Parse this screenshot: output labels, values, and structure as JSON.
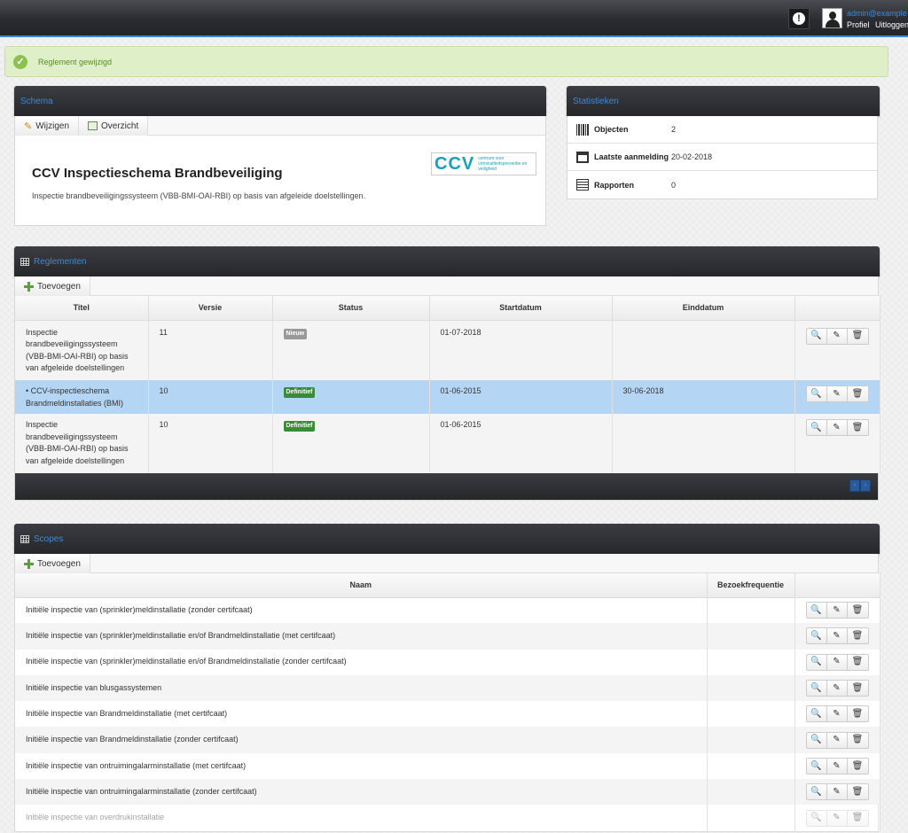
{
  "topbar": {
    "user_email": "admin@example.com",
    "profile_link": "Profiel",
    "logout_link": "Uitloggen",
    "alert_glyph": "!"
  },
  "flash": {
    "message": "Reglement gewijzigd"
  },
  "schema": {
    "panel_title": "Schema",
    "edit_label": "Wijzigen",
    "overview_label": "Overzicht",
    "title": "CCV Inspectieschema Brandbeveiliging",
    "description": "Inspectie brandbeveiligingssysteem (VBB-BMI-OAI-RBI) op basis van afgeleide doelstellingen.",
    "logo_text": "CCV",
    "logo_subtext": "centrum voor criminaliteitspreventie en veiligheid"
  },
  "statistics": {
    "panel_title": "Statistieken",
    "rows": [
      {
        "icon": "barcode-icon",
        "label": "Objecten",
        "value": "2"
      },
      {
        "icon": "calendar-icon",
        "label": "Laatste aanmelding",
        "value": "20-02-2018"
      },
      {
        "icon": "clipboard-icon",
        "label": "Rapporten",
        "value": "0"
      }
    ]
  },
  "reglementen": {
    "panel_title": "Reglementen",
    "add_label": "Toevoegen",
    "columns": [
      "Titel",
      "Versie",
      "Status",
      "Startdatum",
      "Einddatum"
    ],
    "rows": [
      {
        "title": "Inspectie brandbeveiligingssysteem (VBB-BMI-OAI-RBI) op basis van afgeleide doelstellingen",
        "version": "11",
        "status": "Nieuw",
        "start": "01-07-2018",
        "end": ""
      },
      {
        "title": "• CCV-inspectieschema Brandmeldinstallaties (BMI)",
        "version": "10",
        "status": "Definitief",
        "start": "01-06-2015",
        "end": "30-06-2018"
      },
      {
        "title": "Inspectie brandbeveiligingssysteem (VBB-BMI-OAI-RBI) op basis van afgeleide doelstellingen",
        "version": "10",
        "status": "Definitief",
        "start": "01-06-2015",
        "end": ""
      }
    ],
    "pager_prev": "‹",
    "pager_next": "›"
  },
  "scopes": {
    "panel_title": "Scopes",
    "add_label": "Toevoegen",
    "columns": [
      "Naam",
      "Bezoekfrequentie"
    ],
    "rows": [
      {
        "name": "Initiële inspectie van (sprinkler)meldinstallatie (zonder certifcaat)",
        "frequency": ""
      },
      {
        "name": "Initiële inspectie van (sprinkler)meldinstallatie en/of Brandmeldinstallatie (met certifcaat)",
        "frequency": ""
      },
      {
        "name": "Initiële inspectie van (sprinkler)meldinstallatie en/of Brandmeldinstallatie (zonder certifcaat)",
        "frequency": ""
      },
      {
        "name": "Initiële inspectie van blusgassystemen",
        "frequency": ""
      },
      {
        "name": "Initiële inspectie van Brandmeldinstallatie (met certifcaat)",
        "frequency": ""
      },
      {
        "name": "Initiële inspectie van Brandmeldinstallatie (zonder certifcaat)",
        "frequency": ""
      },
      {
        "name": "Initiële inspectie van ontruimingalarminstallatie (met certifcaat)",
        "frequency": ""
      },
      {
        "name": "Initiële inspectie van ontruimingalarminstallatie (zonder certifcaat)",
        "frequency": ""
      },
      {
        "name": "Initiële inspectie van overdrukinstallatie",
        "frequency": ""
      }
    ]
  },
  "action_icons": {
    "view": "🔍",
    "edit": "✎",
    "delete": "🗑"
  },
  "colors": {
    "accent": "#3c8ad6",
    "selected_row": "#b5d5f5",
    "status_new": "#999999",
    "status_final": "#3a8a3a"
  }
}
